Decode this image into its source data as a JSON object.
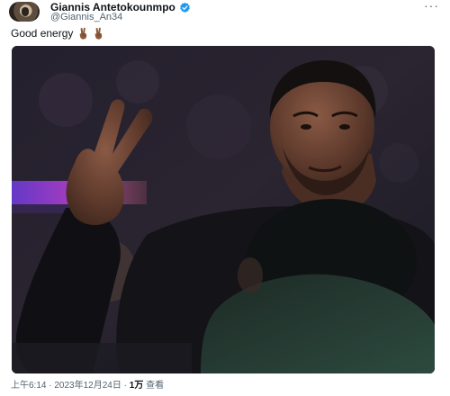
{
  "author": {
    "display_name": "Giannis Antetokounmpo",
    "handle": "@Giannis_An34",
    "verified": true,
    "verified_color": "#1d9bf0"
  },
  "tweet": {
    "text": "Good energy",
    "emojis": [
      "victory-hand-emoji",
      "victory-hand-emoji"
    ]
  },
  "menu": {
    "more_label": "···"
  },
  "footer": {
    "time": "上午6:14",
    "separator": "·",
    "date": "2023年12月24日",
    "views_count": "1万",
    "views_label": "查看"
  },
  "colors": {
    "text_primary": "#0f1419",
    "text_secondary": "#536471",
    "background": "#ffffff"
  }
}
